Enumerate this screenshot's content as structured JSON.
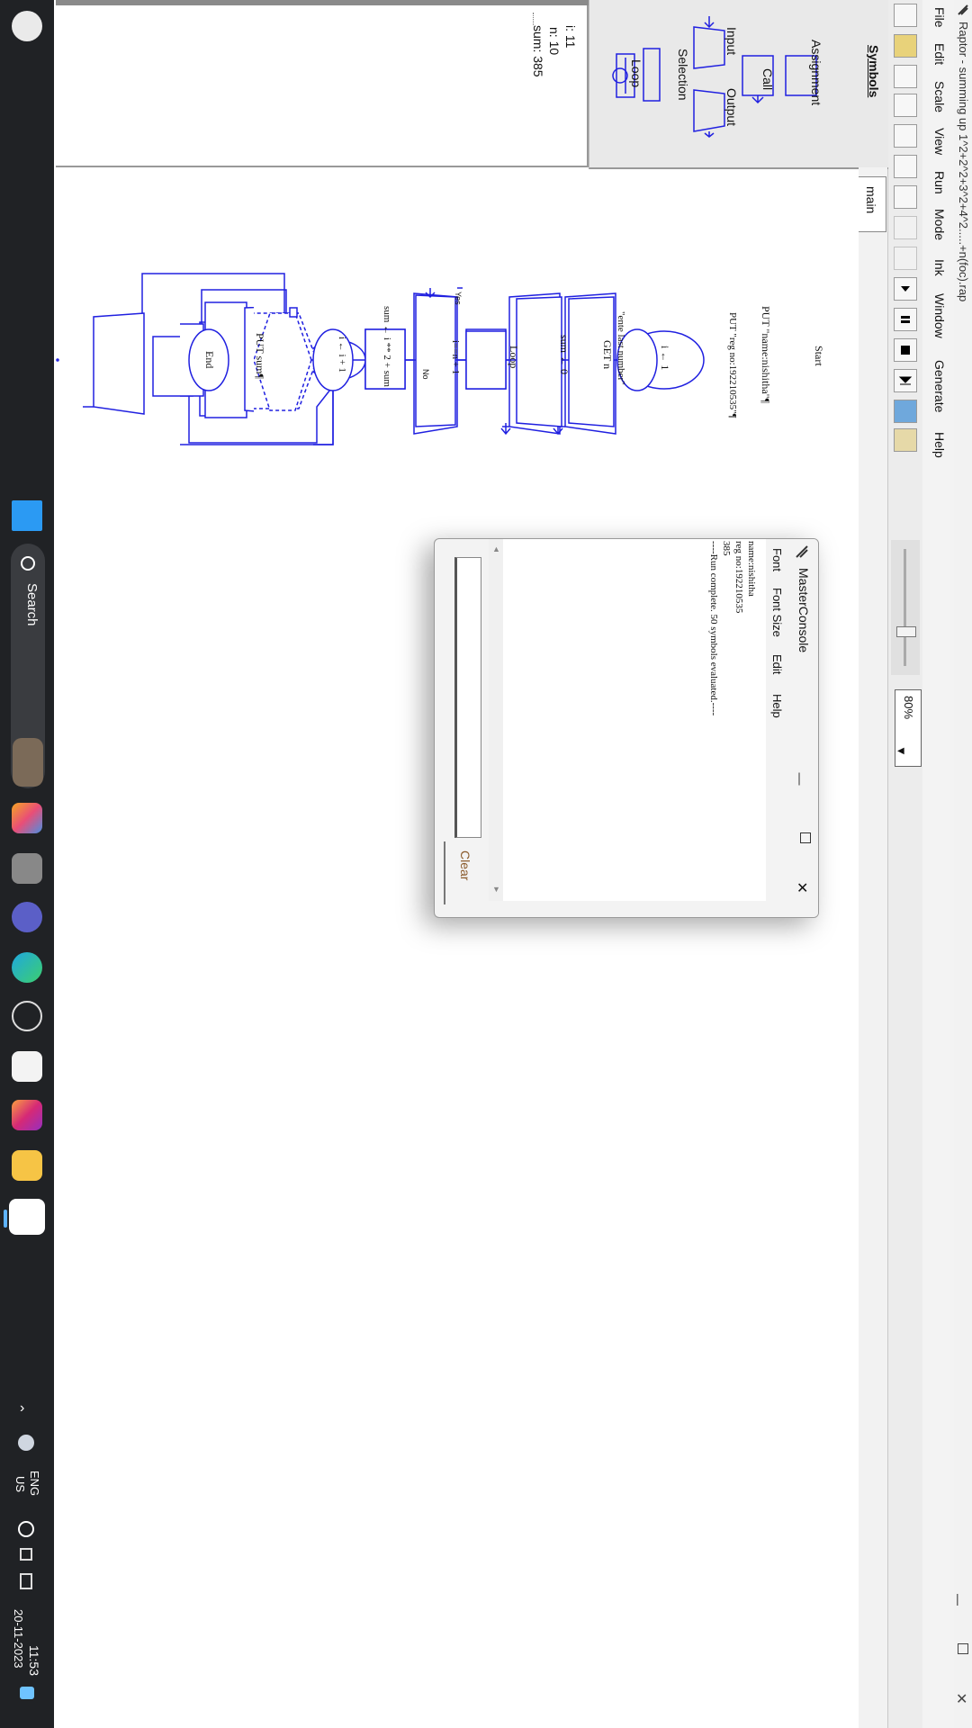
{
  "window": {
    "title": "Raptor - summing up 1^2+2^2+3^2+4^2.....+n(foc).rap",
    "menu": [
      "File",
      "Edit",
      "Scale",
      "View",
      "Run",
      "Mode",
      "Ink",
      "Window",
      "Generate",
      "Help"
    ],
    "zoom": "80%",
    "tab": "main"
  },
  "symbols": {
    "heading": "Symbols",
    "items": [
      "Assignment",
      "Call",
      "Input",
      "Output",
      "Selection",
      "Loop"
    ]
  },
  "watch": {
    "variables": [
      "i: 11",
      "n: 10",
      "sum: 385"
    ]
  },
  "flowchart": {
    "start": "Start",
    "put_name": "PUT \"name:nishitha\"¶",
    "put_reg": "PUT \"reg no:192210535\"¶",
    "assign_i": "i ← 1",
    "get_prompt": "\"ente last number\"",
    "get_var": "GET n",
    "assign_sum": "sum ← 0",
    "loop": "Loop",
    "condition": "i==n + 1",
    "yes": "Yes",
    "no": "No",
    "body_sum": "sum ← i ** 2 + sum",
    "body_inc": "i ← i + 1",
    "put_sum": "PUT sum¶",
    "end": "End"
  },
  "console": {
    "title": "MasterConsole",
    "menu": [
      "Font",
      "Font Size",
      "Edit",
      "Help"
    ],
    "lines": [
      "name:nishitha",
      "reg no:192210535",
      "385",
      "----Run complete.  50 symbols evaluated.----"
    ],
    "clear_label": "Clear"
  },
  "taskbar": {
    "search_label": "Search",
    "language": "ENG",
    "region": "US",
    "time": "11:53",
    "date": "20-11-2023"
  },
  "colors": {
    "flow_blue": "#2020e0",
    "taskbar_bg": "#202225"
  },
  "icons": [
    "windows-start-icon",
    "search-icon",
    "copilot-icon",
    "task-view-icon",
    "teams-icon",
    "edge-icon",
    "dell-icon",
    "store-icon",
    "instagram-icon",
    "file-explorer-icon",
    "raptor-icon",
    "chevron-up-icon",
    "weather-icon",
    "globe-icon",
    "volume-icon",
    "battery-icon",
    "notification-icon"
  ]
}
